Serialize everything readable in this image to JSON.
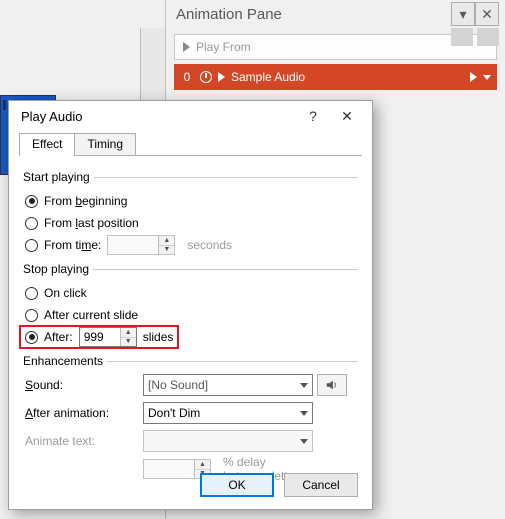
{
  "animPane": {
    "title": "Animation Pane",
    "playFrom": "Play From",
    "item": {
      "index": "0",
      "label": "Sample Audio"
    }
  },
  "dialog": {
    "title": "Play Audio",
    "tabs": {
      "effect": "Effect",
      "timing": "Timing"
    },
    "start": {
      "legend": "Start playing",
      "fromBeginningPrefix": "From ",
      "fromBeginningHot": "b",
      "fromBeginningSuffix": "eginning",
      "fromLastPrefix": "From ",
      "fromLastHot": "l",
      "fromLastSuffix": "ast position",
      "fromTimePrefix": "From ti",
      "fromTimeHot": "m",
      "fromTimeSuffix": "e:",
      "fromTimeValue": "",
      "seconds": "seconds"
    },
    "stop": {
      "legend": "Stop playing",
      "onClick": "On click",
      "afterCurrent": "After current slide",
      "afterLabel": "After:",
      "afterValue": "999",
      "slides": "slides"
    },
    "enh": {
      "legend": "Enhancements",
      "soundLabelHot": "S",
      "soundLabelRest": "ound:",
      "soundValue": "[No Sound]",
      "afterAnimHot": "A",
      "afterAnimRest": "fter animation:",
      "afterAnimValue": "Don't Dim",
      "animateText": "Animate text:",
      "delayValue": "",
      "delayLabel": "% delay between letters"
    },
    "buttons": {
      "ok": "OK",
      "cancel": "Cancel"
    }
  }
}
